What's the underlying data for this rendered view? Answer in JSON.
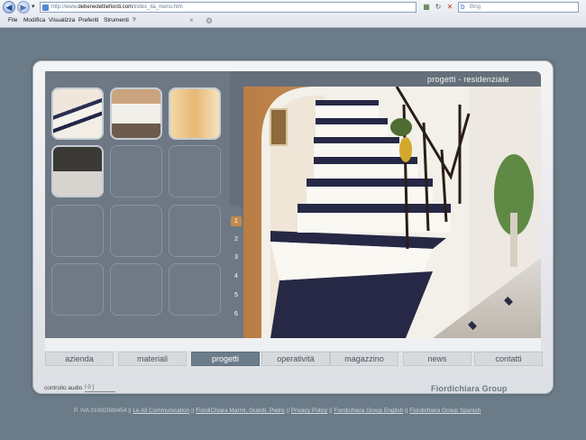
{
  "browser": {
    "address": "http://www.debenedettiefiordi.com/index_ita_menu.htm",
    "address_prefix": "http://www.",
    "address_domain": "debenedettiefiordi.com",
    "address_path": "/index_ita_menu.htm",
    "search_placeholder": "Bing",
    "menu": [
      "File",
      "Modifica",
      "Visualizza",
      "Preferiti",
      "Strumenti",
      "?"
    ]
  },
  "page": {
    "section_title": "progetti - residenziale",
    "page_numbers": [
      "1",
      "2",
      "3",
      "4",
      "5",
      "6"
    ],
    "active_page": "1",
    "nav": [
      "azienda",
      "materiali",
      "progetti",
      "operatività",
      "magazzino",
      "news",
      "contatti"
    ],
    "active_nav": "progetti",
    "audio_label": "controllo audio",
    "audio_value": "I 0 ]",
    "brand": "Fiordichiara Group"
  },
  "footer": {
    "vat": "P. IVA 01092080454 ||",
    "links": [
      "Le Ali Communication",
      "FiordiChiara Marmi, Graniti, Pietre",
      "Privacy Policy",
      "Fiordichiara Group English",
      "Fiordichiara Group Spanish"
    ],
    "separator": "||"
  },
  "colors": {
    "background": "#6b7b88",
    "accent": "#c58a4e",
    "active_nav": "#6d7c8b"
  }
}
